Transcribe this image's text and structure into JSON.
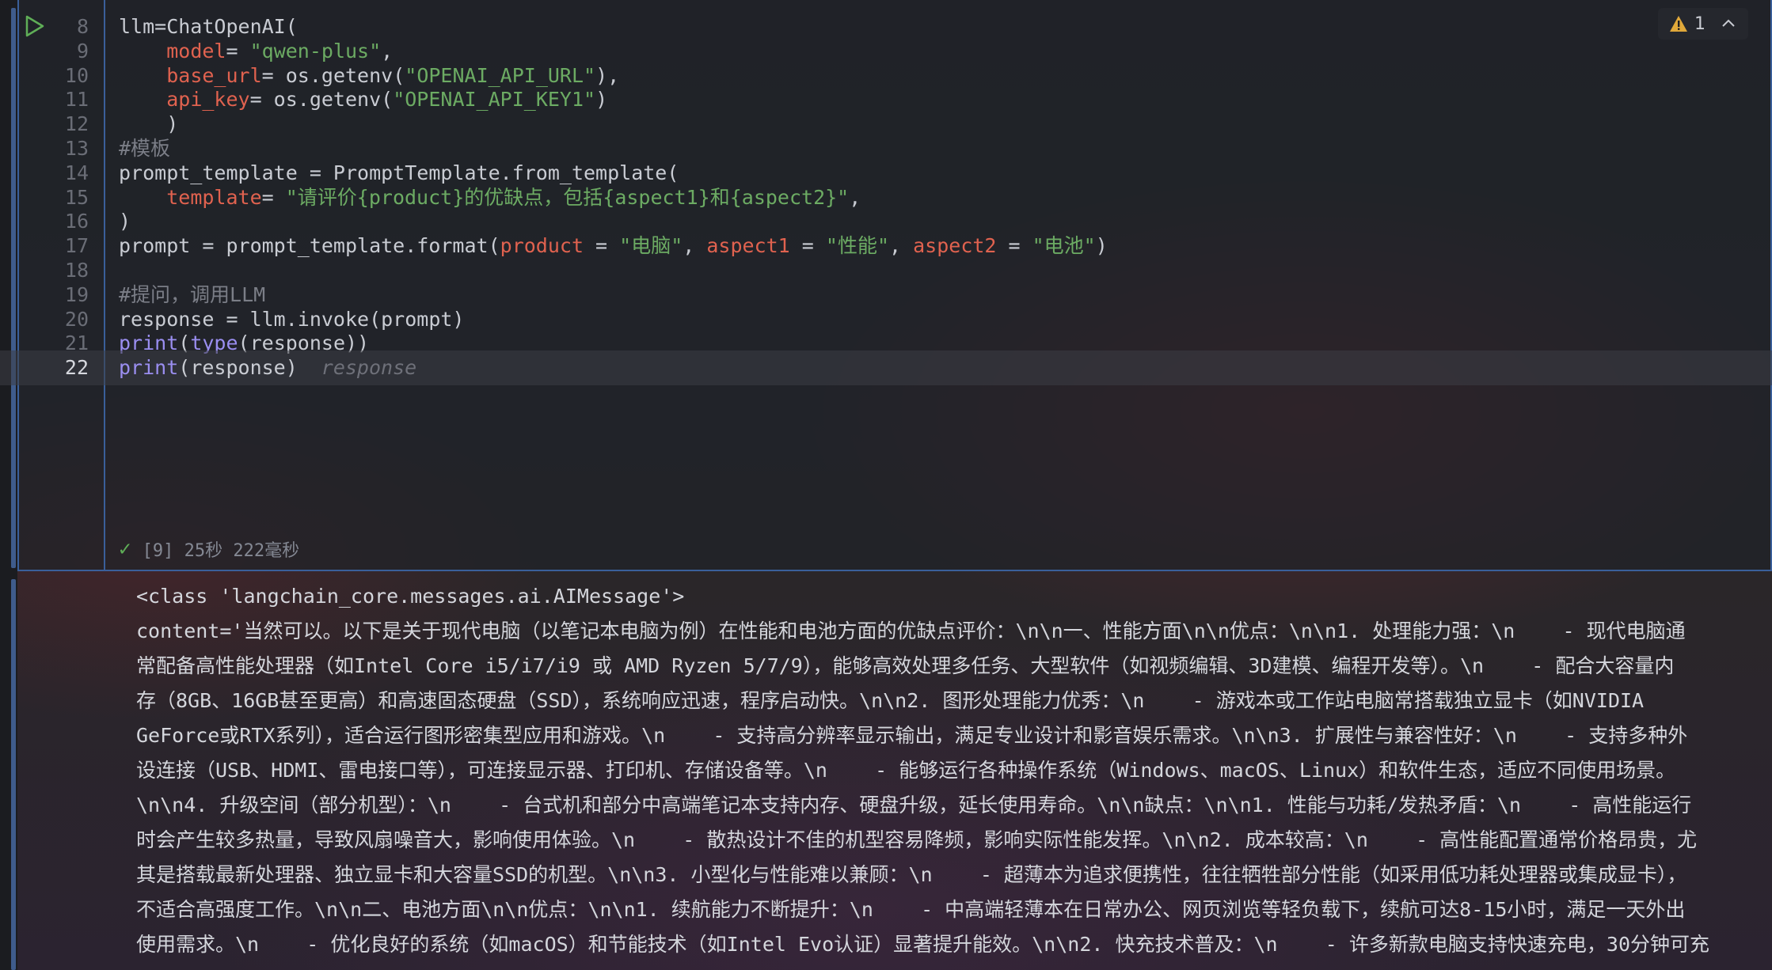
{
  "editor": {
    "warning_count": "1",
    "inlay_hint": "response",
    "lines": [
      {
        "num": "8",
        "segments": [
          {
            "t": "llm=ChatOpenAI(",
            "c": "plain"
          }
        ]
      },
      {
        "num": "9",
        "segments": [
          {
            "t": "    ",
            "c": "plain"
          },
          {
            "t": "model",
            "c": "param"
          },
          {
            "t": "= ",
            "c": "plain"
          },
          {
            "t": "\"qwen-plus\"",
            "c": "str"
          },
          {
            "t": ",",
            "c": "plain"
          }
        ]
      },
      {
        "num": "10",
        "segments": [
          {
            "t": "    ",
            "c": "plain"
          },
          {
            "t": "base_url",
            "c": "param"
          },
          {
            "t": "= os.getenv(",
            "c": "plain"
          },
          {
            "t": "\"OPENAI_API_URL\"",
            "c": "str"
          },
          {
            "t": "),",
            "c": "plain"
          }
        ]
      },
      {
        "num": "11",
        "segments": [
          {
            "t": "    ",
            "c": "plain"
          },
          {
            "t": "api_key",
            "c": "param"
          },
          {
            "t": "= os.getenv(",
            "c": "plain"
          },
          {
            "t": "\"OPENAI_API_KEY1\"",
            "c": "str"
          },
          {
            "t": ")",
            "c": "plain"
          }
        ]
      },
      {
        "num": "12",
        "segments": [
          {
            "t": "    )",
            "c": "plain"
          }
        ]
      },
      {
        "num": "13",
        "segments": [
          {
            "t": "#模板",
            "c": "cmt"
          }
        ]
      },
      {
        "num": "14",
        "segments": [
          {
            "t": "prompt_template = PromptTemplate.from_template(",
            "c": "plain"
          }
        ]
      },
      {
        "num": "15",
        "segments": [
          {
            "t": "    ",
            "c": "plain"
          },
          {
            "t": "template",
            "c": "param"
          },
          {
            "t": "= ",
            "c": "plain"
          },
          {
            "t": "\"请评价{product}的优缺点，包括{aspect1}和{aspect2}\"",
            "c": "str"
          },
          {
            "t": ",",
            "c": "plain"
          }
        ]
      },
      {
        "num": "16",
        "segments": [
          {
            "t": ")",
            "c": "plain"
          }
        ]
      },
      {
        "num": "17",
        "segments": [
          {
            "t": "prompt = prompt_template.format(",
            "c": "plain"
          },
          {
            "t": "product",
            "c": "param"
          },
          {
            "t": " = ",
            "c": "plain"
          },
          {
            "t": "\"电脑\"",
            "c": "str"
          },
          {
            "t": ", ",
            "c": "plain"
          },
          {
            "t": "aspect1",
            "c": "param"
          },
          {
            "t": " = ",
            "c": "plain"
          },
          {
            "t": "\"性能\"",
            "c": "str"
          },
          {
            "t": ", ",
            "c": "plain"
          },
          {
            "t": "aspect2",
            "c": "param"
          },
          {
            "t": " = ",
            "c": "plain"
          },
          {
            "t": "\"电池\"",
            "c": "str"
          },
          {
            "t": ")",
            "c": "plain"
          }
        ]
      },
      {
        "num": "18",
        "segments": [
          {
            "t": "",
            "c": "plain"
          }
        ]
      },
      {
        "num": "19",
        "segments": [
          {
            "t": "#提问，调用LLM",
            "c": "cmt"
          }
        ]
      },
      {
        "num": "20",
        "segments": [
          {
            "t": "response = llm.invoke(prompt)",
            "c": "plain"
          }
        ]
      },
      {
        "num": "21",
        "segments": [
          {
            "t": "print",
            "c": "builtin"
          },
          {
            "t": "(",
            "c": "plain"
          },
          {
            "t": "type",
            "c": "builtin"
          },
          {
            "t": "(response))",
            "c": "plain"
          }
        ]
      },
      {
        "num": "22",
        "segments": [
          {
            "t": "print",
            "c": "builtin"
          },
          {
            "t": "(response)",
            "c": "plain"
          }
        ],
        "current": true
      }
    ]
  },
  "execution": {
    "status_text": "[9] 25秒 222毫秒"
  },
  "output": {
    "lines": [
      "<class 'langchain_core.messages.ai.AIMessage'>",
      "content='当然可以。以下是关于现代电脑（以笔记本电脑为例）在性能和电池方面的优缺点评价：\\n\\n一、性能方面\\n\\n优点：\\n\\n1. 处理能力强：\\n    - 现代电脑通",
      "常配备高性能处理器（如Intel Core i5/i7/i9 或 AMD Ryzen 5/7/9），能够高效处理多任务、大型软件（如视频编辑、3D建模、编程开发等）。\\n    - 配合大容量内",
      "存（8GB、16GB甚至更高）和高速固态硬盘（SSD），系统响应迅速，程序启动快。\\n\\n2. 图形处理能力优秀：\\n    - 游戏本或工作站电脑常搭载独立显卡（如NVIDIA",
      "GeForce或RTX系列），适合运行图形密集型应用和游戏。\\n    - 支持高分辨率显示输出，满足专业设计和影音娱乐需求。\\n\\n3. 扩展性与兼容性好：\\n    - 支持多种外",
      "设连接（USB、HDMI、雷电接口等），可连接显示器、打印机、存储设备等。\\n    - 能够运行各种操作系统（Windows、macOS、Linux）和软件生态，适应不同使用场景。",
      "\\n\\n4. 升级空间（部分机型）：\\n    - 台式机和部分中高端笔记本支持内存、硬盘升级，延长使用寿命。\\n\\n缺点：\\n\\n1. 性能与功耗/发热矛盾：\\n    - 高性能运行",
      "时会产生较多热量，导致风扇噪音大，影响使用体验。\\n    - 散热设计不佳的机型容易降频，影响实际性能发挥。\\n\\n2. 成本较高：\\n    - 高性能配置通常价格昂贵，尤",
      "其是搭载最新处理器、独立显卡和大容量SSD的机型。\\n\\n3. 小型化与性能难以兼顾：\\n    - 超薄本为追求便携性，往往牺牲部分性能（如采用低功耗处理器或集成显卡），",
      "不适合高强度工作。\\n\\n二、电池方面\\n\\n优点：\\n\\n1. 续航能力不断提升：\\n    - 中高端轻薄本在日常办公、网页浏览等轻负载下，续航可达8-15小时，满足一天外出",
      "使用需求。\\n    - 优化良好的系统（如macOS）和节能技术（如Intel Evo认证）显著提升能效。\\n\\n2. 快充技术普及：\\n    - 许多新款电脑支持快速充电，30分钟可充"
    ]
  }
}
